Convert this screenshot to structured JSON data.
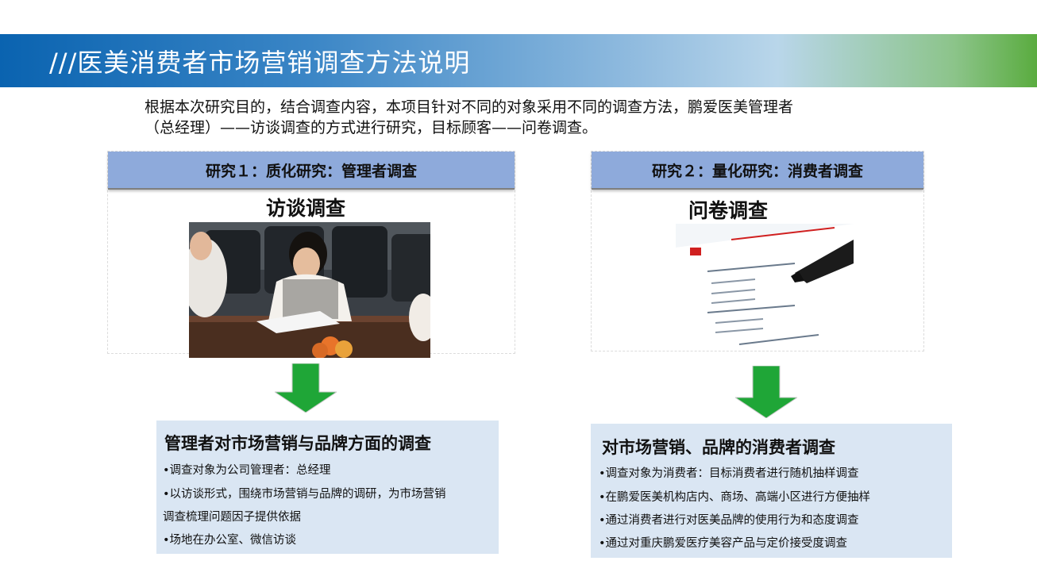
{
  "title": "///医美消费者市场营销调查方法说明",
  "intro": {
    "line1": "根据本次研究目的，结合调查内容，本项目针对不同的对象采用不同的调查方法，鹏爱医美管理者",
    "line2": "（总经理）——访谈调查的方式进行研究，目标顾客——问卷调查。"
  },
  "study1": {
    "header": "研究１：质化研究：管理者调查",
    "method": "访谈调查",
    "box_title": "管理者对市场营销与品牌方面的调查",
    "items": [
      "•调查对象为公司管理者：总经理",
      "•以访谈形式，围绕市场营销与品牌的调研，为市场营销",
      "调查梳理问题因子提供依据",
      "•场地在办公室、微信访谈"
    ]
  },
  "study2": {
    "header": "研究２：量化研究：消费者调查",
    "method": "问卷调查",
    "box_title": "对市场营销、品牌的消费者调查",
    "items": [
      "•调查对象为消费者：目标消费者进行随机抽样调查",
      "•在鹏爱医美机构店内、商场、高端小区进行方便抽样",
      "•通过消费者进行对医美品牌的使用行为和态度调查",
      "•通过对重庆鹏爱医疗美容产品与定价接受度调查"
    ]
  },
  "colors": {
    "header_bg": "#8eaadb",
    "box_bg": "#dae6f3",
    "arrow": "#1fa637"
  }
}
